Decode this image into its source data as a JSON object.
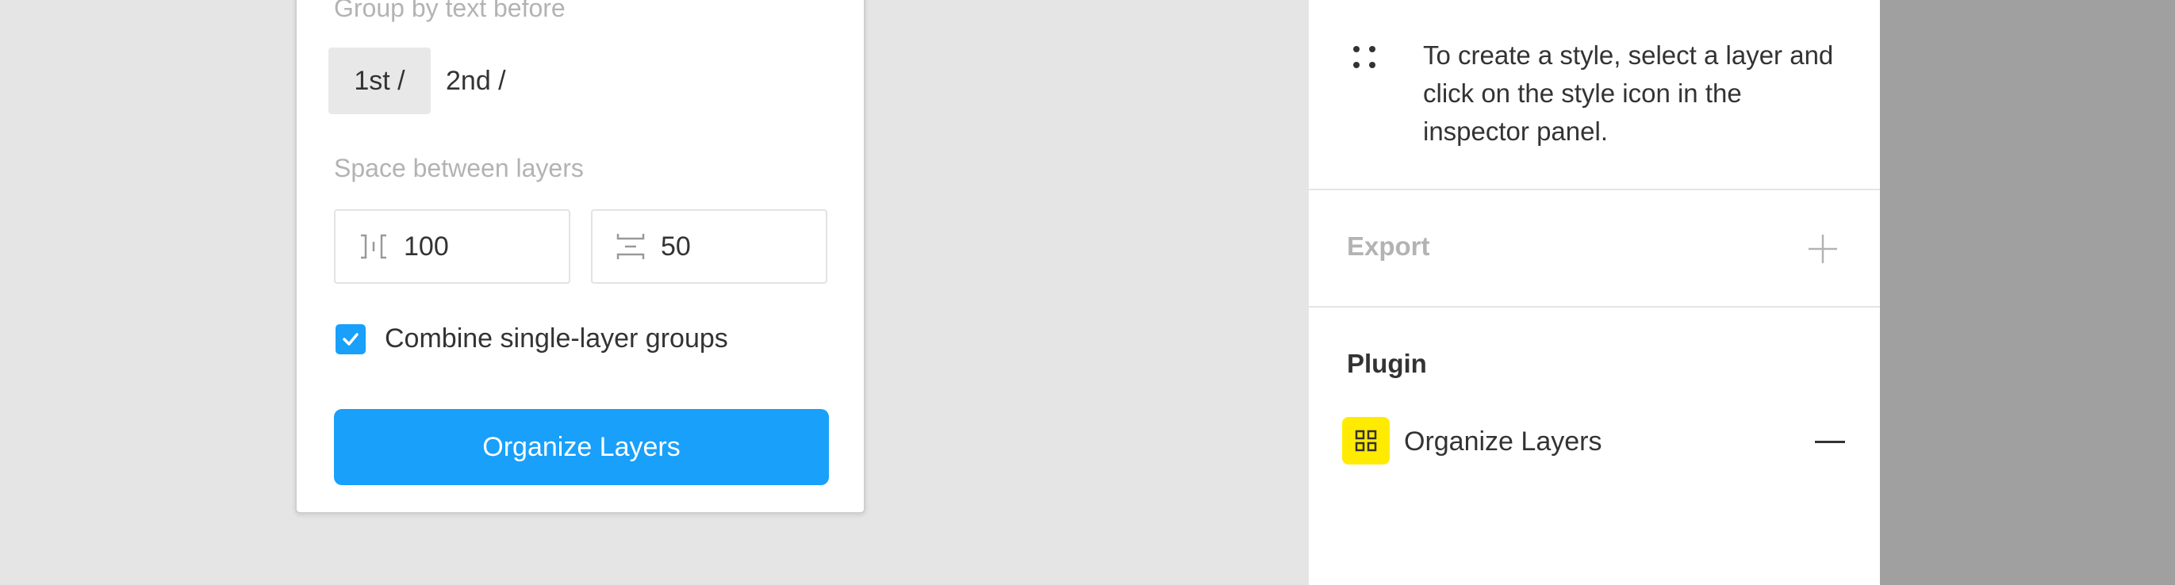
{
  "dialog": {
    "group_label": "Group by text before",
    "group_options": [
      "1st /",
      "2nd /"
    ],
    "space_label": "Space between layers",
    "horizontal_spacing": "100",
    "vertical_spacing": "50",
    "combine_label": "Combine single-layer groups",
    "combine_checked": true,
    "submit_label": "Organize Layers",
    "accent_color": "#18a0fb"
  },
  "inspector": {
    "style_hint": "To create a style, select a layer and click on the style icon in the inspector panel.",
    "export_label": "Export",
    "plugin_heading": "Plugin",
    "plugin_name": "Organize Layers",
    "plugin_icon_color": "#ffeb00",
    "icons": [
      "four-dots-icon",
      "plus-icon",
      "grid-icon",
      "minus-icon"
    ]
  }
}
